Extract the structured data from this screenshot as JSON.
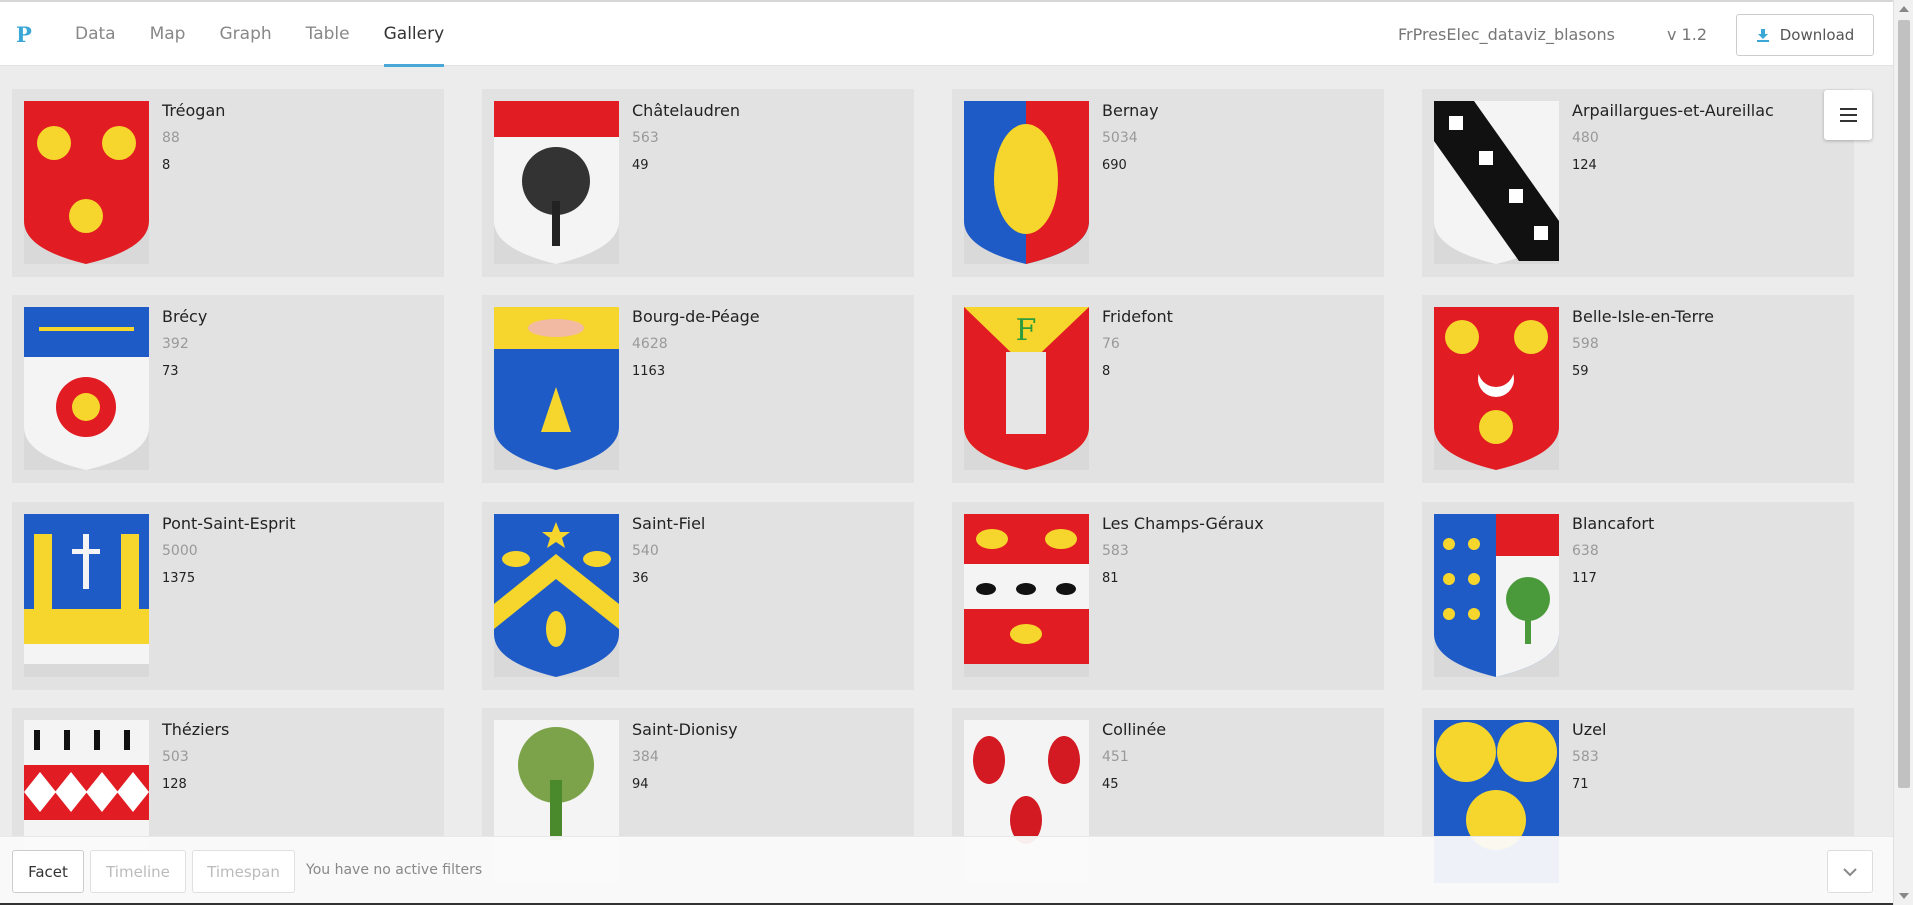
{
  "app": {
    "logo": "P",
    "tabs": [
      {
        "label": "Data",
        "active": false
      },
      {
        "label": "Map",
        "active": false
      },
      {
        "label": "Graph",
        "active": false
      },
      {
        "label": "Table",
        "active": false
      },
      {
        "label": "Gallery",
        "active": true
      }
    ],
    "project_name": "FrPresElec_dataviz_blasons",
    "version": "v 1.2",
    "download_label": "Download"
  },
  "colors": {
    "accent": "#4aa8d8",
    "card_bg": "#e2e2e2",
    "page_bg": "#ececec"
  },
  "gallery": {
    "cards": [
      {
        "name": "Tréogan",
        "v1": "88",
        "v2": "8",
        "icon": "blazon-shells-red"
      },
      {
        "name": "Châtelaudren",
        "v1": "563",
        "v2": "49",
        "icon": "blazon-tree-ermine"
      },
      {
        "name": "Bernay",
        "v1": "5034",
        "v2": "690",
        "icon": "blazon-lion-blue-red"
      },
      {
        "name": "Arpaillargues-et-Aureillac",
        "v1": "480",
        "v2": "124",
        "icon": "blazon-checky-bend"
      },
      {
        "name": "Brécy",
        "v1": "392",
        "v2": "73",
        "icon": "blazon-wheat-lion"
      },
      {
        "name": "Bourg-de-Péage",
        "v1": "4628",
        "v2": "1163",
        "icon": "blazon-beehive"
      },
      {
        "name": "Fridefont",
        "v1": "76",
        "v2": "8",
        "icon": "blazon-tower-lilies"
      },
      {
        "name": "Belle-Isle-en-Terre",
        "v1": "598",
        "v2": "59",
        "icon": "blazon-shells-crescent"
      },
      {
        "name": "Pont-Saint-Esprit",
        "v1": "5000",
        "v2": "1375",
        "icon": "blazon-bridge-towers"
      },
      {
        "name": "Saint-Fiel",
        "v1": "540",
        "v2": "36",
        "icon": "blazon-chevron-leaves"
      },
      {
        "name": "Les Champs-Géraux",
        "v1": "583",
        "v2": "81",
        "icon": "blazon-wolves-ducks"
      },
      {
        "name": "Blancafort",
        "v1": "638",
        "v2": "117",
        "icon": "blazon-bezants-tree"
      },
      {
        "name": "Théziers",
        "v1": "503",
        "v2": "128",
        "icon": "blazon-ermine-lozenges"
      },
      {
        "name": "Saint-Dionisy",
        "v1": "384",
        "v2": "94",
        "icon": "blazon-olive-tree"
      },
      {
        "name": "Collinée",
        "v1": "451",
        "v2": "45",
        "icon": "blazon-pinecones"
      },
      {
        "name": "Uzel",
        "v1": "583",
        "v2": "71",
        "icon": "blazon-three-bezants"
      }
    ]
  },
  "bottom": {
    "facet_label": "Facet",
    "timeline_label": "Timeline",
    "timespan_label": "Timespan",
    "filters_text": "You have no active filters"
  }
}
